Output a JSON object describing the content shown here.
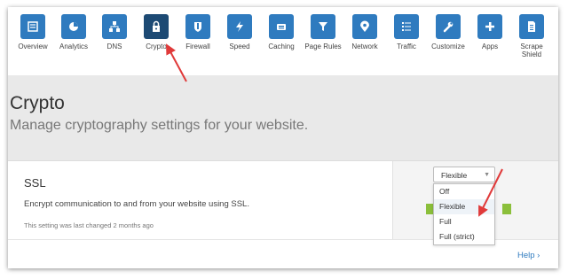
{
  "nav": {
    "items": [
      {
        "label": "Overview",
        "icon": "overview-icon"
      },
      {
        "label": "Analytics",
        "icon": "analytics-icon"
      },
      {
        "label": "DNS",
        "icon": "dns-icon"
      },
      {
        "label": "Crypto",
        "icon": "lock-icon"
      },
      {
        "label": "Firewall",
        "icon": "shield-icon"
      },
      {
        "label": "Speed",
        "icon": "lightning-icon"
      },
      {
        "label": "Caching",
        "icon": "caching-icon"
      },
      {
        "label": "Page Rules",
        "icon": "filter-icon"
      },
      {
        "label": "Network",
        "icon": "location-pin-icon"
      },
      {
        "label": "Traffic",
        "icon": "list-icon"
      },
      {
        "label": "Customize",
        "icon": "wrench-icon"
      },
      {
        "label": "Apps",
        "icon": "plus-icon"
      },
      {
        "label": "Scrape Shield",
        "icon": "document-icon"
      }
    ],
    "active": "Crypto",
    "accent": "#2f7bbf",
    "active_color": "#1d4a74"
  },
  "header": {
    "title": "Crypto",
    "subtitle": "Manage cryptography settings for your website."
  },
  "ssl": {
    "title": "SSL",
    "description": "Encrypt communication to and from your website using SSL.",
    "meta": "This setting was last changed 2 months ago",
    "selected": "Flexible",
    "options": [
      "Off",
      "Flexible",
      "Full",
      "Full (strict)"
    ],
    "help": "Help ›"
  },
  "annotation_color": "#e03a3a"
}
